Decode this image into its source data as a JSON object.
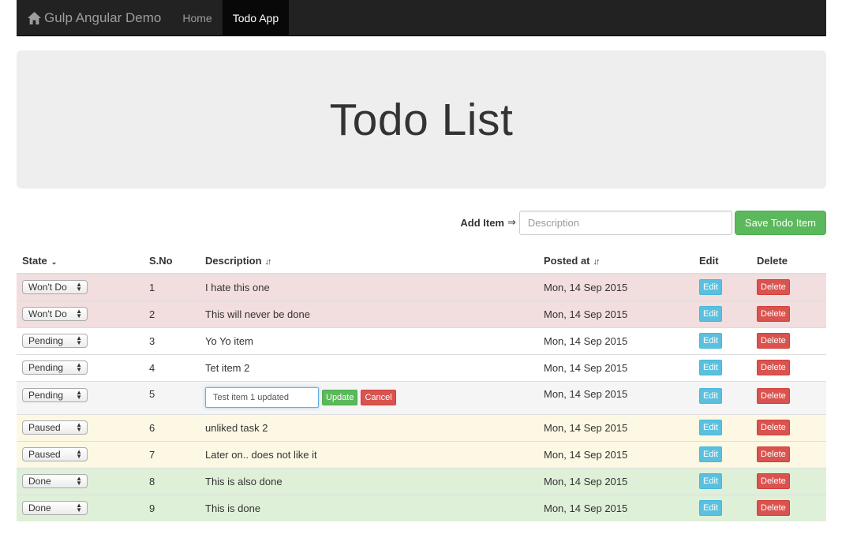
{
  "navbar": {
    "brand": "Gulp Angular Demo",
    "links": [
      {
        "label": "Home",
        "active": false
      },
      {
        "label": "Todo App",
        "active": true
      }
    ]
  },
  "jumbotron": {
    "title": "Todo List"
  },
  "add_form": {
    "label": "Add Item",
    "arrow": "⇒",
    "placeholder": "Description",
    "save_label": "Save Todo Item"
  },
  "table": {
    "headers": {
      "state": "State",
      "sno": "S.No",
      "description": "Description",
      "posted": "Posted at",
      "edit": "Edit",
      "delete": "Delete"
    },
    "edit_label": "Edit",
    "delete_label": "Delete",
    "update_label": "Update",
    "cancel_label": "Cancel",
    "rows": [
      {
        "state": "Won't Do",
        "sno": "1",
        "description": "I hate this one",
        "posted": "Mon, 14 Sep 2015",
        "class": "danger"
      },
      {
        "state": "Won't Do",
        "sno": "2",
        "description": "This will never be done",
        "posted": "Mon, 14 Sep 2015",
        "class": "danger"
      },
      {
        "state": "Pending",
        "sno": "3",
        "description": "Yo Yo item",
        "posted": "Mon, 14 Sep 2015",
        "class": ""
      },
      {
        "state": "Pending",
        "sno": "4",
        "description": "Tet item 2",
        "posted": "Mon, 14 Sep 2015",
        "class": ""
      },
      {
        "state": "Pending",
        "sno": "5",
        "description": "Test item 1 updated",
        "posted": "Mon, 14 Sep 2015",
        "class": "editing",
        "editing": true
      },
      {
        "state": "Paused",
        "sno": "6",
        "description": "unliked task 2",
        "posted": "Mon, 14 Sep 2015",
        "class": "warning"
      },
      {
        "state": "Paused",
        "sno": "7",
        "description": "Later on.. does not like it",
        "posted": "Mon, 14 Sep 2015",
        "class": "warning"
      },
      {
        "state": "Done",
        "sno": "8",
        "description": "This is also done",
        "posted": "Mon, 14 Sep 2015",
        "class": "success"
      },
      {
        "state": "Done",
        "sno": "9",
        "description": "This is done",
        "posted": "Mon, 14 Sep 2015",
        "class": "success"
      }
    ]
  },
  "colors": {
    "navbar_bg": "#222222",
    "jumbotron_bg": "#eeeeee",
    "danger_row": "#f2dede",
    "warning_row": "#fcf8e3",
    "success_row": "#dff0d8",
    "edit_button": "#5bc0de",
    "delete_button": "#d9534f",
    "save_button": "#5cb85c"
  }
}
